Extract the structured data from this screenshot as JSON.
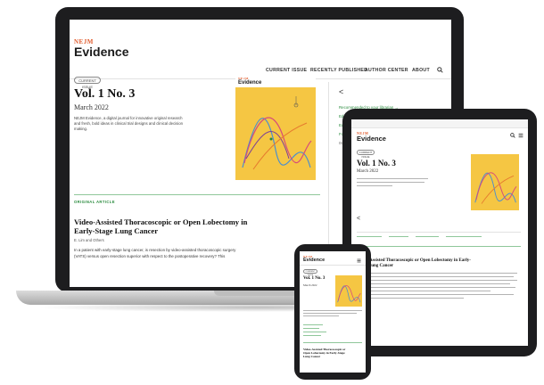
{
  "laptop": {
    "logo": {
      "nejm": "NEJM",
      "evidence": "Evidence"
    },
    "nav": [
      {
        "label": "CURRENT ISSUE",
        "active": true
      },
      {
        "label": "RECENTLY PUBLISHED",
        "active": false
      },
      {
        "label": "AUTHOR CENTER",
        "active": false
      },
      {
        "label": "ABOUT",
        "active": false
      }
    ],
    "issue_badge": "CURRENT ISSUE",
    "volume": "Vol. 1 No. 3",
    "date": "March 2022",
    "description": [
      "NEJM Evidence, a digital journal for innovative original research",
      "and fresh, bold ideas in clinical trial designs and clinical decision",
      "making."
    ],
    "section_tag": "ORIGINAL ARTICLE",
    "article_title": [
      "Video-Assisted Thoracoscopic or Open Lobectomy in",
      "Early-Stage Lung Cancer"
    ],
    "article_authors": "E. Lim and Others",
    "article_abstract": [
      "In a patient with early-stage lung cancer, is resection by video-assisted thoracoscopic surgery",
      "(VATS) versus open resection superior with respect to the postoperative recovery? This"
    ],
    "sidebar": {
      "back_arrow": "<",
      "link_recommended": "Recommended to your librarian →",
      "link_editorial": "Editorial",
      "link_editorial2": "Editorial",
      "link_for": "For Reviewers",
      "issn": "ISSN: 2766-5526"
    }
  },
  "tablet": {
    "logo": {
      "nejm": "NEJM",
      "evidence": "Evidence"
    },
    "issue_badge": "CURRENT ISSUE",
    "volume": "Vol. 1 No. 3",
    "date": "March 2022",
    "back_arrow": "<",
    "article_title": [
      "Video-Assisted Thoracoscopic or Open Lobectomy in Early-",
      "Stage Lung Cancer"
    ]
  },
  "phone": {
    "logo": {
      "nejm": "NEJM",
      "evidence": "Evidence"
    },
    "issue_badge": "CURRENT ISSUE",
    "volume": "Vol. 1 No. 3",
    "date": "March 2022",
    "article_title": [
      "Video-Assisted Thoracoscopic or",
      "Open Lobectomy in Early-Stage",
      "Lung Cancer"
    ]
  },
  "colors": {
    "brand_orange": "#e05a2b",
    "accent_green": "#2a8b3e",
    "cover_yellow": "#f5c643"
  }
}
